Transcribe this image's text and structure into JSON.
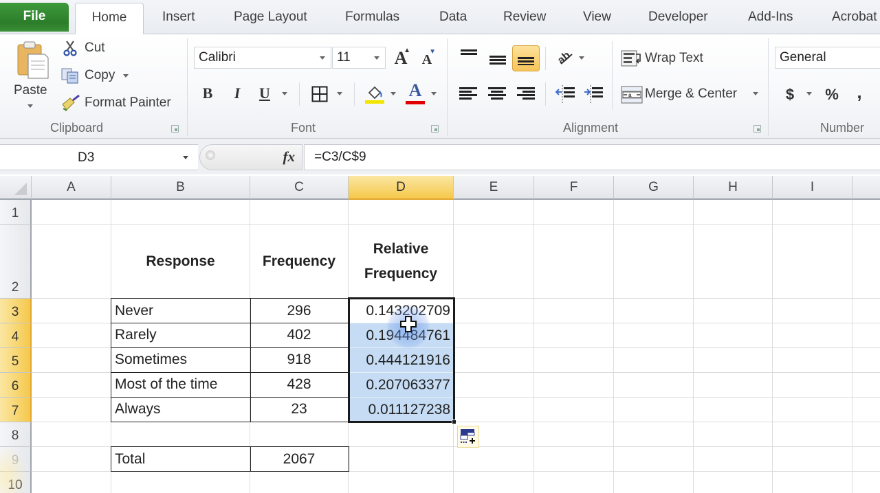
{
  "tabs": [
    {
      "label": "File",
      "active": false
    },
    {
      "label": "Home",
      "active": true
    },
    {
      "label": "Insert",
      "active": false
    },
    {
      "label": "Page Layout",
      "active": false
    },
    {
      "label": "Formulas",
      "active": false
    },
    {
      "label": "Data",
      "active": false
    },
    {
      "label": "Review",
      "active": false
    },
    {
      "label": "View",
      "active": false
    },
    {
      "label": "Developer",
      "active": false
    },
    {
      "label": "Add-Ins",
      "active": false
    },
    {
      "label": "Acrobat",
      "active": false
    }
  ],
  "ribbon": {
    "clipboard": {
      "label": "Clipboard",
      "paste": "Paste",
      "cut": "Cut",
      "copy": "Copy",
      "format_painter": "Format Painter"
    },
    "font": {
      "label": "Font",
      "font_name": "Calibri",
      "font_size": "11",
      "bold": "B",
      "italic": "I",
      "underline": "U",
      "grow": "A",
      "shrink": "A",
      "font_color_glyph": "A",
      "fill_color": "#f2e600",
      "font_color": "#e00000"
    },
    "alignment": {
      "label": "Alignment",
      "wrap_text": "Wrap Text",
      "merge_center": "Merge & Center",
      "active_vertical_align": "bottom"
    },
    "number": {
      "label": "Number",
      "format": "General",
      "currency": "$",
      "percent": "%",
      "comma": ","
    }
  },
  "formula_bar": {
    "name_box": "D3",
    "fx_label": "fx",
    "formula": "=C3/C$9"
  },
  "grid": {
    "columns": [
      "A",
      "B",
      "C",
      "D",
      "E",
      "F",
      "G",
      "H",
      "I"
    ],
    "selected_column": "D",
    "rows": [
      "1",
      "2",
      "3",
      "4",
      "5",
      "6",
      "7",
      "8",
      "9",
      "10"
    ],
    "selected_rows": [
      "3",
      "4",
      "5",
      "6",
      "7"
    ],
    "headers": {
      "response": "Response",
      "frequency": "Frequency",
      "relative_frequency_line1": "Relative",
      "relative_frequency_line2": "Frequency"
    },
    "data_rows": [
      {
        "response": "Never",
        "frequency": "296",
        "relative": "0.143202709"
      },
      {
        "response": "Rarely",
        "frequency": "402",
        "relative": "0.194484761"
      },
      {
        "response": "Sometimes",
        "frequency": "918",
        "relative": "0.444121916"
      },
      {
        "response": "Most of the time",
        "frequency": "428",
        "relative": "0.207063377"
      },
      {
        "response": "Always",
        "frequency": "23",
        "relative": "0.011127238"
      }
    ],
    "total": {
      "label": "Total",
      "value": "2067"
    },
    "selection_range": "D3:D7",
    "selection_color": "#c5dcf4",
    "header_highlight_color": "#f5c84c"
  }
}
